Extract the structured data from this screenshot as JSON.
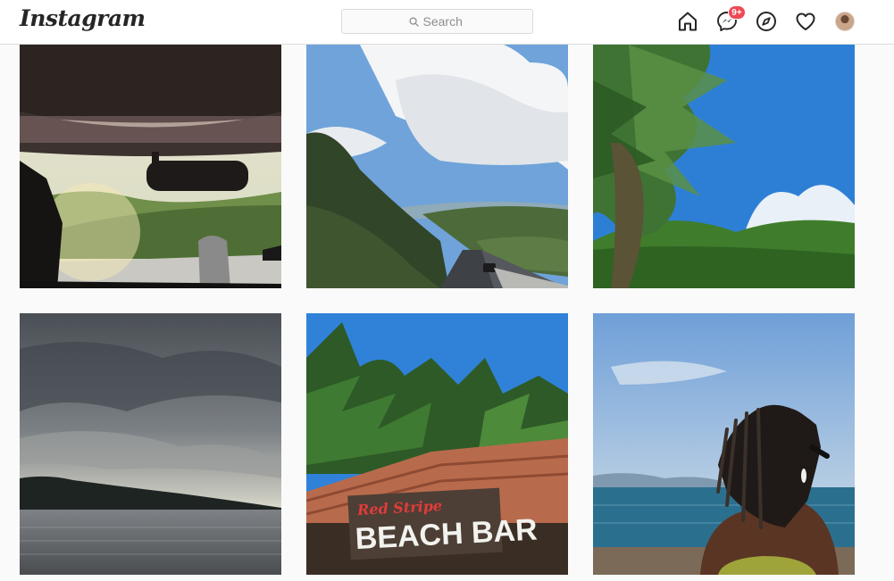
{
  "header": {
    "logo_text": "Instagram",
    "search": {
      "placeholder": "Search",
      "icon": "search-icon"
    },
    "nav": [
      {
        "name": "home",
        "icon": "home-icon"
      },
      {
        "name": "direct-messages",
        "icon": "messenger-icon",
        "badge": "9+"
      },
      {
        "name": "explore",
        "icon": "compass-icon"
      },
      {
        "name": "activity",
        "icon": "heart-icon"
      },
      {
        "name": "profile",
        "icon": "avatar"
      }
    ]
  },
  "photo_grid": {
    "posts": [
      {
        "subject": "car-interior-highway"
      },
      {
        "subject": "road-clouds-hills"
      },
      {
        "subject": "palm-tree-blur-sky"
      },
      {
        "subject": "stormy-sky-sea"
      },
      {
        "subject": "red-stripe-beach-bar",
        "sign_lines": [
          "Red Stripe",
          "BEACH BAR"
        ]
      },
      {
        "subject": "woman-locs-sea"
      }
    ]
  },
  "colors": {
    "header_bg": "#ffffff",
    "page_bg": "#fafafa",
    "border": "#dbdbdb",
    "badge": "#ed4956",
    "text_dark": "#262626",
    "text_muted": "#8e8e8e"
  }
}
